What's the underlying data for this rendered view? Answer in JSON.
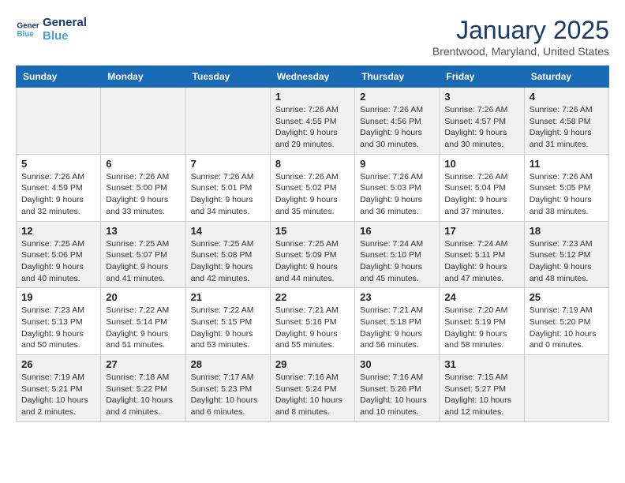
{
  "logo": {
    "line1": "General",
    "line2": "Blue"
  },
  "title": "January 2025",
  "location": "Brentwood, Maryland, United States",
  "weekdays": [
    "Sunday",
    "Monday",
    "Tuesday",
    "Wednesday",
    "Thursday",
    "Friday",
    "Saturday"
  ],
  "weeks": [
    [
      {
        "day": "",
        "info": ""
      },
      {
        "day": "",
        "info": ""
      },
      {
        "day": "",
        "info": ""
      },
      {
        "day": "1",
        "info": "Sunrise: 7:26 AM\nSunset: 4:55 PM\nDaylight: 9 hours\nand 29 minutes."
      },
      {
        "day": "2",
        "info": "Sunrise: 7:26 AM\nSunset: 4:56 PM\nDaylight: 9 hours\nand 30 minutes."
      },
      {
        "day": "3",
        "info": "Sunrise: 7:26 AM\nSunset: 4:57 PM\nDaylight: 9 hours\nand 30 minutes."
      },
      {
        "day": "4",
        "info": "Sunrise: 7:26 AM\nSunset: 4:58 PM\nDaylight: 9 hours\nand 31 minutes."
      }
    ],
    [
      {
        "day": "5",
        "info": "Sunrise: 7:26 AM\nSunset: 4:59 PM\nDaylight: 9 hours\nand 32 minutes."
      },
      {
        "day": "6",
        "info": "Sunrise: 7:26 AM\nSunset: 5:00 PM\nDaylight: 9 hours\nand 33 minutes."
      },
      {
        "day": "7",
        "info": "Sunrise: 7:26 AM\nSunset: 5:01 PM\nDaylight: 9 hours\nand 34 minutes."
      },
      {
        "day": "8",
        "info": "Sunrise: 7:26 AM\nSunset: 5:02 PM\nDaylight: 9 hours\nand 35 minutes."
      },
      {
        "day": "9",
        "info": "Sunrise: 7:26 AM\nSunset: 5:03 PM\nDaylight: 9 hours\nand 36 minutes."
      },
      {
        "day": "10",
        "info": "Sunrise: 7:26 AM\nSunset: 5:04 PM\nDaylight: 9 hours\nand 37 minutes."
      },
      {
        "day": "11",
        "info": "Sunrise: 7:26 AM\nSunset: 5:05 PM\nDaylight: 9 hours\nand 38 minutes."
      }
    ],
    [
      {
        "day": "12",
        "info": "Sunrise: 7:25 AM\nSunset: 5:06 PM\nDaylight: 9 hours\nand 40 minutes."
      },
      {
        "day": "13",
        "info": "Sunrise: 7:25 AM\nSunset: 5:07 PM\nDaylight: 9 hours\nand 41 minutes."
      },
      {
        "day": "14",
        "info": "Sunrise: 7:25 AM\nSunset: 5:08 PM\nDaylight: 9 hours\nand 42 minutes."
      },
      {
        "day": "15",
        "info": "Sunrise: 7:25 AM\nSunset: 5:09 PM\nDaylight: 9 hours\nand 44 minutes."
      },
      {
        "day": "16",
        "info": "Sunrise: 7:24 AM\nSunset: 5:10 PM\nDaylight: 9 hours\nand 45 minutes."
      },
      {
        "day": "17",
        "info": "Sunrise: 7:24 AM\nSunset: 5:11 PM\nDaylight: 9 hours\nand 47 minutes."
      },
      {
        "day": "18",
        "info": "Sunrise: 7:23 AM\nSunset: 5:12 PM\nDaylight: 9 hours\nand 48 minutes."
      }
    ],
    [
      {
        "day": "19",
        "info": "Sunrise: 7:23 AM\nSunset: 5:13 PM\nDaylight: 9 hours\nand 50 minutes."
      },
      {
        "day": "20",
        "info": "Sunrise: 7:22 AM\nSunset: 5:14 PM\nDaylight: 9 hours\nand 51 minutes."
      },
      {
        "day": "21",
        "info": "Sunrise: 7:22 AM\nSunset: 5:15 PM\nDaylight: 9 hours\nand 53 minutes."
      },
      {
        "day": "22",
        "info": "Sunrise: 7:21 AM\nSunset: 5:16 PM\nDaylight: 9 hours\nand 55 minutes."
      },
      {
        "day": "23",
        "info": "Sunrise: 7:21 AM\nSunset: 5:18 PM\nDaylight: 9 hours\nand 56 minutes."
      },
      {
        "day": "24",
        "info": "Sunrise: 7:20 AM\nSunset: 5:19 PM\nDaylight: 9 hours\nand 58 minutes."
      },
      {
        "day": "25",
        "info": "Sunrise: 7:19 AM\nSunset: 5:20 PM\nDaylight: 10 hours\nand 0 minutes."
      }
    ],
    [
      {
        "day": "26",
        "info": "Sunrise: 7:19 AM\nSunset: 5:21 PM\nDaylight: 10 hours\nand 2 minutes."
      },
      {
        "day": "27",
        "info": "Sunrise: 7:18 AM\nSunset: 5:22 PM\nDaylight: 10 hours\nand 4 minutes."
      },
      {
        "day": "28",
        "info": "Sunrise: 7:17 AM\nSunset: 5:23 PM\nDaylight: 10 hours\nand 6 minutes."
      },
      {
        "day": "29",
        "info": "Sunrise: 7:16 AM\nSunset: 5:24 PM\nDaylight: 10 hours\nand 8 minutes."
      },
      {
        "day": "30",
        "info": "Sunrise: 7:16 AM\nSunset: 5:26 PM\nDaylight: 10 hours\nand 10 minutes."
      },
      {
        "day": "31",
        "info": "Sunrise: 7:15 AM\nSunset: 5:27 PM\nDaylight: 10 hours\nand 12 minutes."
      },
      {
        "day": "",
        "info": ""
      }
    ]
  ]
}
